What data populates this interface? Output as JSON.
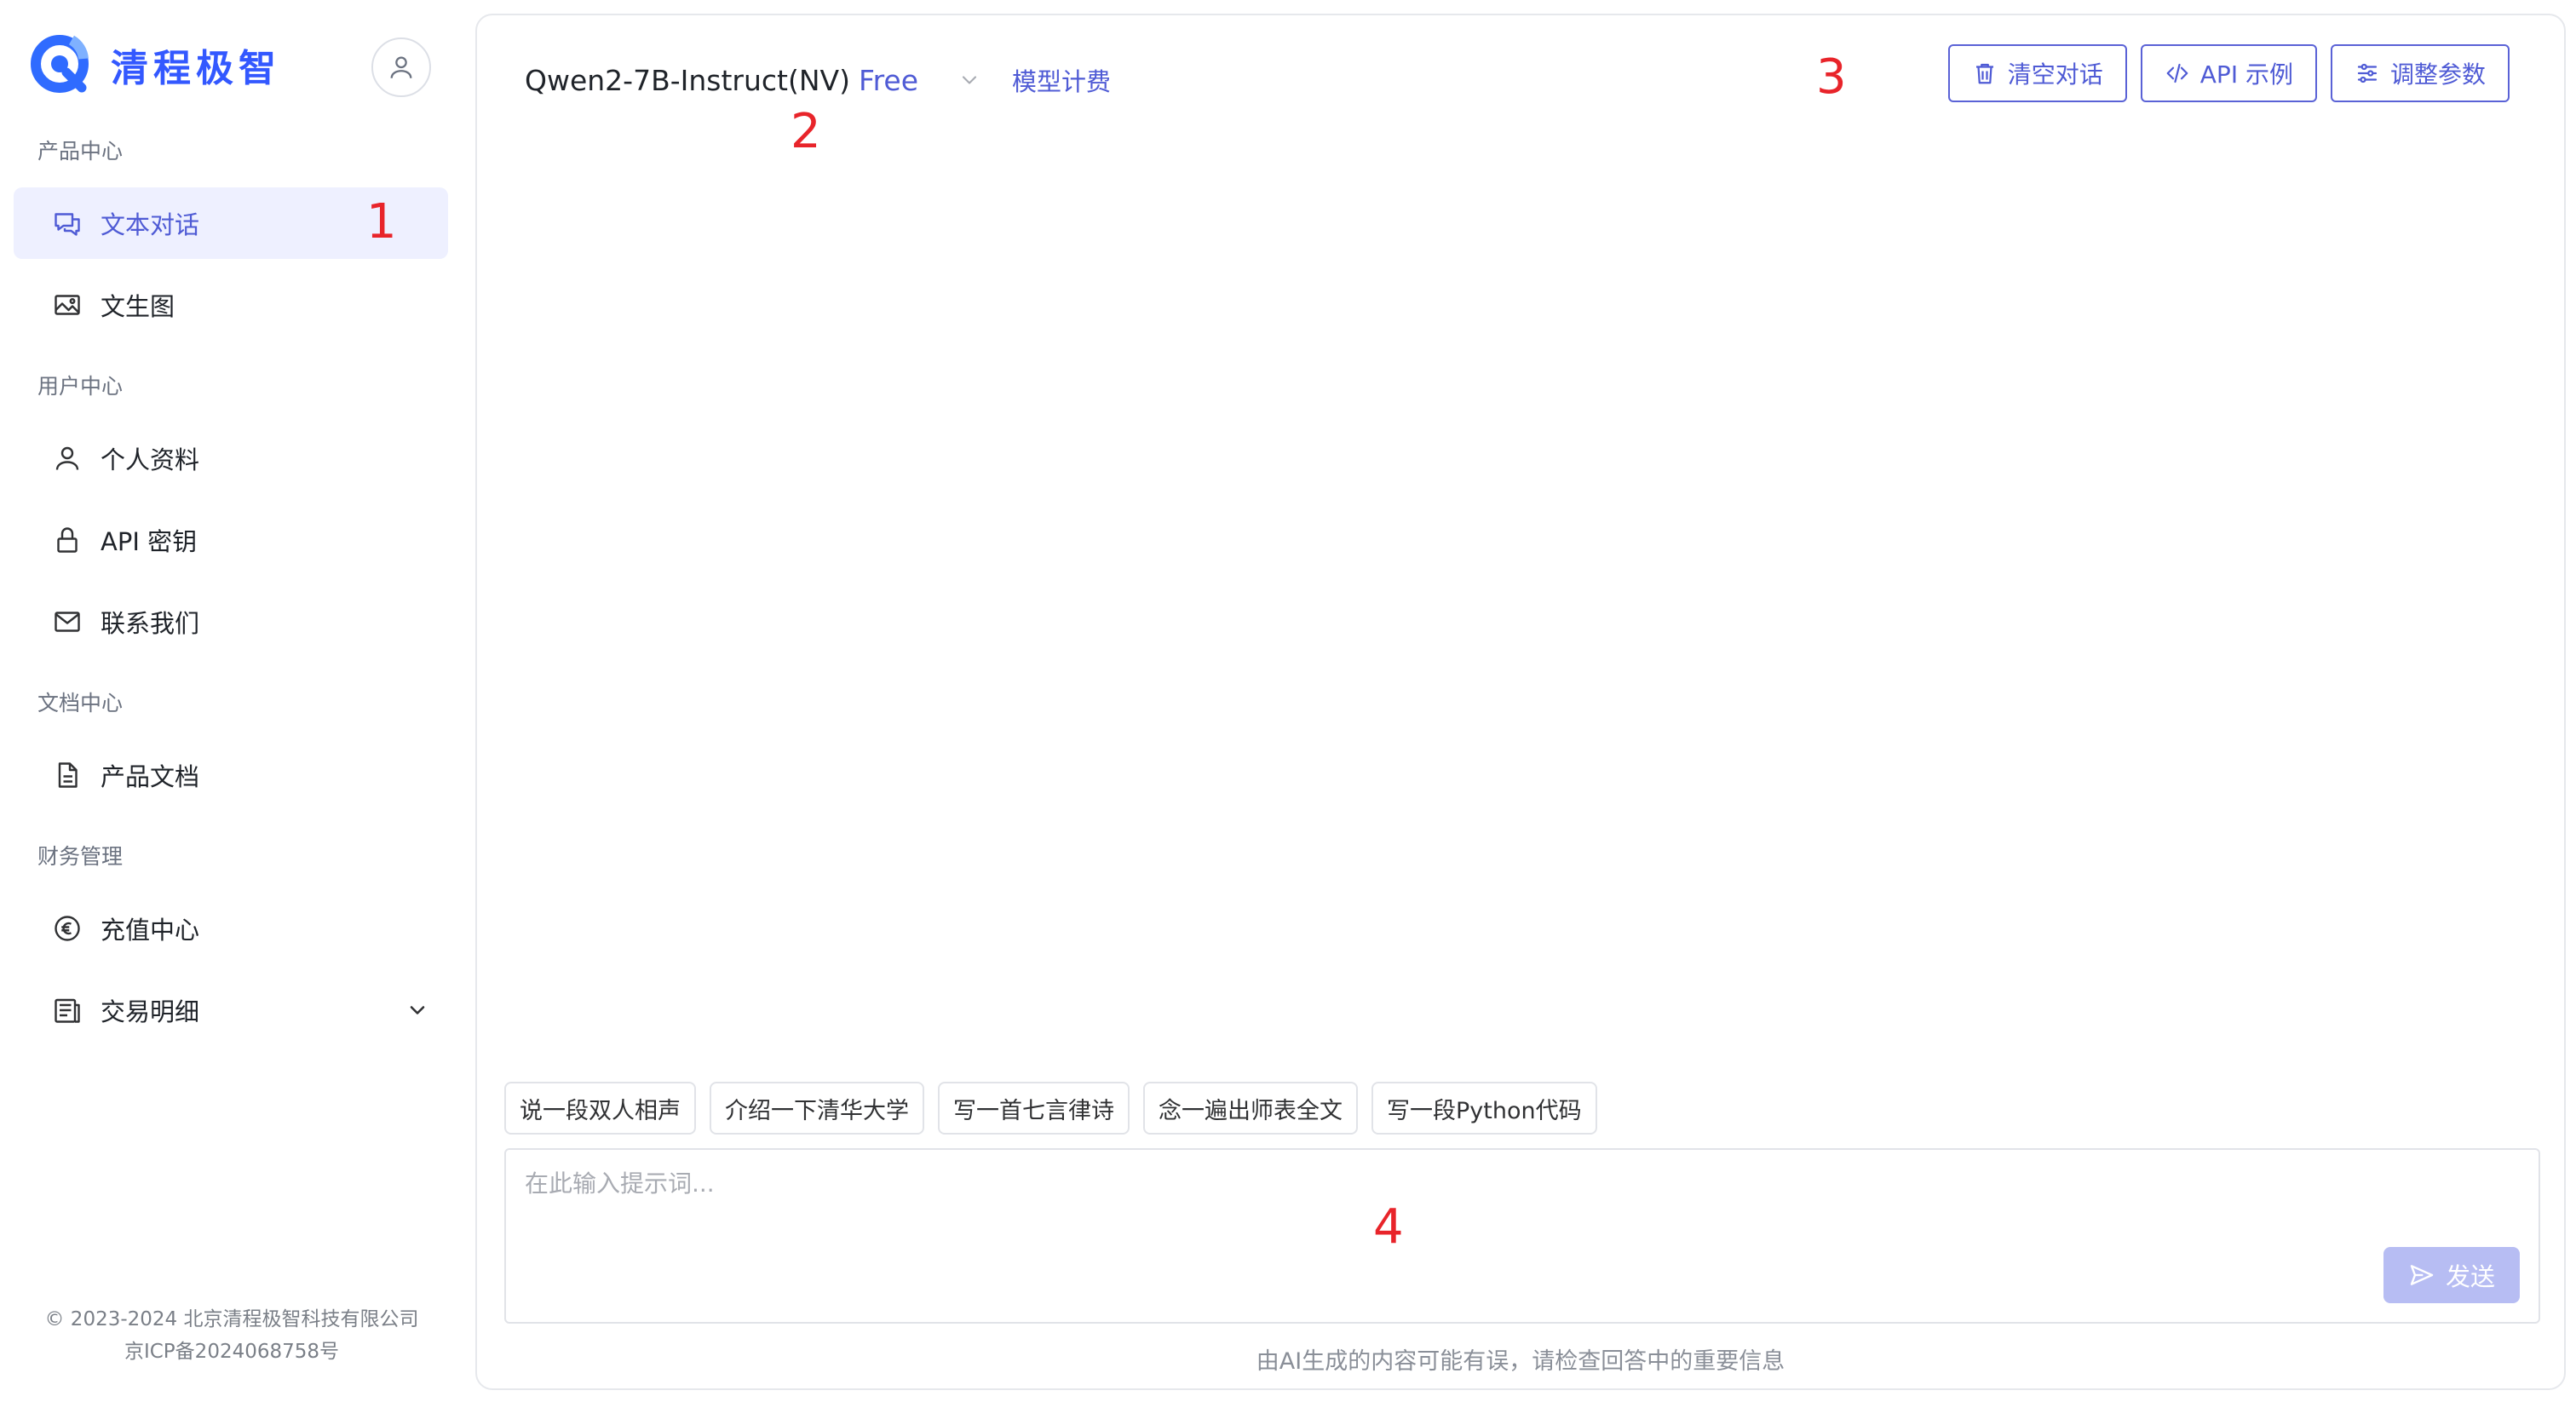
{
  "brand": {
    "name": "清程极智"
  },
  "sidebar": {
    "sections": [
      {
        "title": "产品中心",
        "items": [
          {
            "label": "文本对话",
            "icon": "chat-icon",
            "active": true
          },
          {
            "label": "文生图",
            "icon": "image-icon"
          }
        ]
      },
      {
        "title": "用户中心",
        "items": [
          {
            "label": "个人资料",
            "icon": "user-icon"
          },
          {
            "label": "API 密钥",
            "icon": "lock-icon"
          },
          {
            "label": "联系我们",
            "icon": "mail-icon"
          }
        ]
      },
      {
        "title": "文档中心",
        "items": [
          {
            "label": "产品文档",
            "icon": "document-icon"
          }
        ]
      },
      {
        "title": "财务管理",
        "items": [
          {
            "label": "充值中心",
            "icon": "euro-icon"
          },
          {
            "label": "交易明细",
            "icon": "ledger-icon"
          }
        ]
      }
    ],
    "footer": {
      "copyright": "© 2023-2024 北京清程极智科技有限公司",
      "icp": "京ICP备2024068758号"
    }
  },
  "header": {
    "model_name": "Qwen2-7B-Instruct(NV)",
    "model_tag": "Free",
    "pricing_link": "模型计费",
    "buttons": {
      "clear": "清空对话",
      "api": "API 示例",
      "params": "调整参数"
    }
  },
  "annotations": {
    "a1": "1",
    "a2": "2",
    "a3": "3",
    "a4": "4"
  },
  "suggestions": [
    "说一段双人相声",
    "介绍一下清华大学",
    "写一首七言律诗",
    "念一遍出师表全文",
    "写一段Python代码"
  ],
  "input": {
    "placeholder": "在此输入提示词...",
    "value": ""
  },
  "send_label": "发送",
  "disclaimer": "由AI生成的内容可能有误，请检查回答中的重要信息",
  "colors": {
    "accent": "#4f5bd5",
    "brand": "#3358ff",
    "annotation": "#e8242a",
    "send_disabled": "#b7bdf3",
    "active_bg": "#eef0ff"
  }
}
